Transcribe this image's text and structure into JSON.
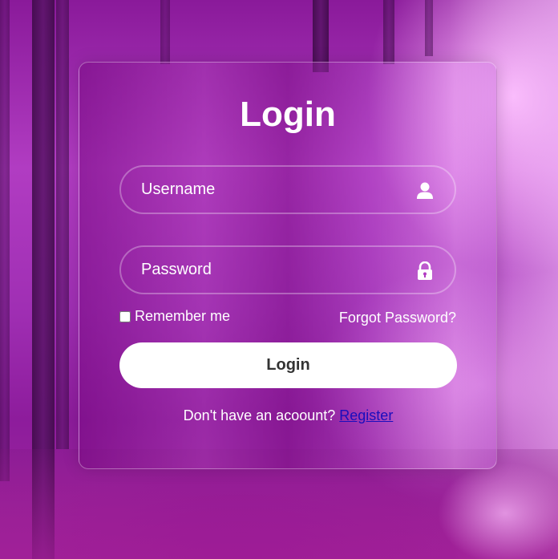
{
  "title": "Login",
  "username": {
    "placeholder": "Username",
    "value": "",
    "icon": "user-icon"
  },
  "password": {
    "placeholder": "Password",
    "value": "",
    "icon": "lock-icon"
  },
  "remember": {
    "label": "Remember me",
    "checked": false
  },
  "forgot_label": "Forgot Password?",
  "login_button_label": "Login",
  "register": {
    "prompt": "Don't have an acoount?",
    "link_label": "Register"
  },
  "colors": {
    "accent_text": "#ffffff",
    "button_text": "#333333",
    "link": "#1a0dbd",
    "background": "#a02fb4"
  }
}
